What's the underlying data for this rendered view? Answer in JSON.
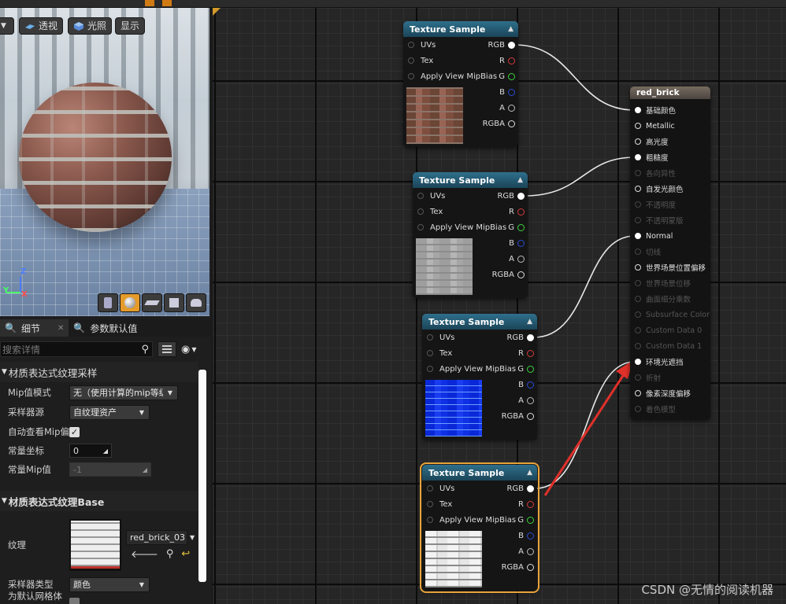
{
  "toolbar": {
    "items": [
      "",
      "",
      "",
      "",
      "",
      "",
      "",
      "",
      "",
      "",
      "",
      "",
      "",
      "",
      "",
      ""
    ]
  },
  "viewport": {
    "perspective_label": "透视",
    "lit_label": "光照",
    "show_label": "显示",
    "axis_z": "Z",
    "axis_x": "X",
    "axis_y": "Y"
  },
  "details": {
    "tab_details": "细节",
    "tab_params": "参数默认值",
    "search_placeholder": "搜索详情",
    "section1": "材质表达式纹理采样",
    "mip_mode_label": "Mip值模式",
    "mip_mode_value": "无（使用计算的mip等级",
    "sampler_source_label": "采样器源",
    "sampler_source_value": "自纹理资产",
    "auto_mip_label": "自动查看Mip偏",
    "const_coord_label": "常量坐标",
    "const_coord_value": "0",
    "const_mip_label": "常量Mip值",
    "const_mip_value": "-1",
    "section2": "材质表达式纹理Base",
    "texture_label": "纹理",
    "texture_value": "red_brick_03",
    "sampler_type_label": "采样器类型",
    "sampler_type_value": "颜色",
    "default_mesh_label": "为默认网格体纹"
  },
  "nodes": {
    "title": "Texture Sample",
    "in_uvs": "UVs",
    "in_tex": "Tex",
    "in_mip": "Apply View MipBias",
    "out_rgb": "RGB",
    "out_r": "R",
    "out_g": "G",
    "out_b": "B",
    "out_a": "A",
    "out_rgba": "RGBA"
  },
  "result": {
    "title": "red_brick",
    "pins": [
      "基础颜色",
      "Metallic",
      "高光度",
      "粗糙度",
      "各向异性",
      "自发光颜色",
      "不透明度",
      "不透明蒙版",
      "Normal",
      "切线",
      "世界场景位置偏移",
      "世界场景位移",
      "曲面细分乘数",
      "Subsurface Color",
      "Custom Data 0",
      "Custom Data 1",
      "环境光遮挡",
      "折射",
      "像素深度偏移",
      "着色模型"
    ]
  },
  "colors": {
    "accent": "#e8a33a",
    "node_header": "#2f6f8c",
    "pin_r": "#d43a3a",
    "pin_g": "#3ad43a",
    "pin_b": "#2a4bd4",
    "arrow": "#e0302a"
  },
  "watermark": "CSDN @无情的阅读机器"
}
